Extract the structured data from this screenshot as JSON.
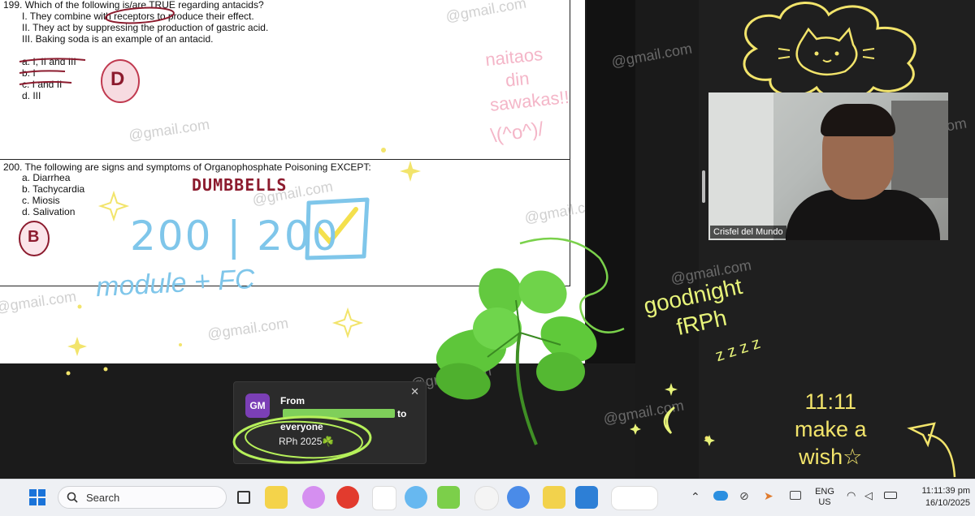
{
  "exam": {
    "q199": {
      "stem": "199.  Which of the following is/are TRUE regarding antacids?",
      "statements": [
        "I.     They combine with receptors to produce their effect.",
        "II.    They act by suppressing the production of gastric acid.",
        "III.   Baking soda is an example of an antacid."
      ],
      "choices": [
        "a.     I, II and III",
        "b.     I",
        "c.     I and II",
        "d.     III"
      ],
      "handwritten_answer": "D"
    },
    "q200": {
      "stem": "200.  The following are signs and symptoms of Organophosphate Poisoning EXCEPT:",
      "choices": [
        "a.     Diarrhea",
        "b.     Tachycardia",
        "c.     Miosis",
        "d.     Salivation"
      ],
      "handwritten_answer": "B"
    }
  },
  "annotations": {
    "dumbbells": "DUMBBELLS",
    "score": "200 | 200",
    "module": "module + FC",
    "naitaos": [
      "naitaos",
      "din",
      "sawakas!!"
    ],
    "face": "\\(^o^)/",
    "goodnight": [
      "goodnight",
      "fRPh"
    ],
    "zzz": "z z z z",
    "wish": [
      "11:11",
      "make a",
      "wish☆"
    ]
  },
  "watermark": "@gmail.com",
  "video": {
    "participant_name": "Crisfel del Mundo"
  },
  "chat_toast": {
    "avatar_initials": "GM",
    "from_prefix": "From",
    "from_suffix": "to",
    "recipient": "everyone",
    "message": "RPh 2025☘️",
    "close": "✕"
  },
  "taskbar": {
    "search_label": "Search",
    "language": [
      "ENG",
      "US"
    ],
    "time": "11:11:39 pm",
    "date": "16/10/2025"
  },
  "colors": {
    "clover": "#5fc93a",
    "doodle_yellow": "#e8f47a",
    "marker_red": "#8c1b2e",
    "marker_blue": "#7fc6ea",
    "marker_pink": "#f4b6c8",
    "avatar": "#7b3fb6"
  }
}
